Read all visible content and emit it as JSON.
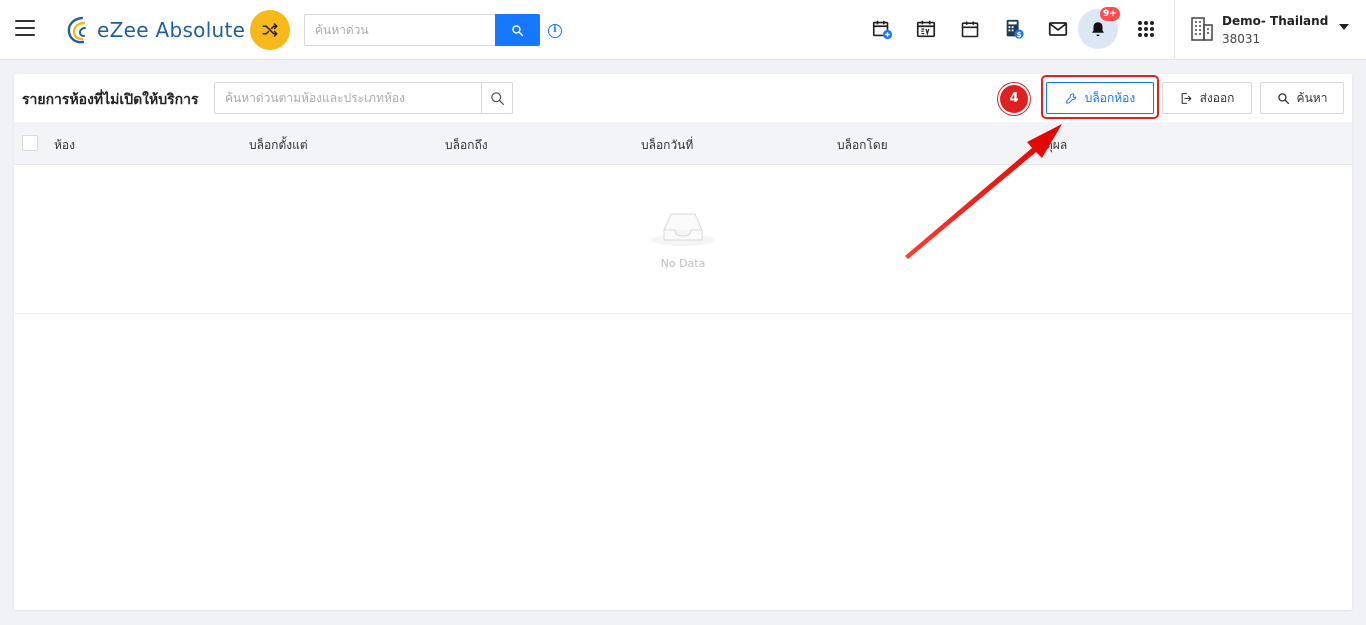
{
  "header": {
    "brand": "eZee Absolute",
    "search_placeholder": "ค้นหาด่วน",
    "notification_badge": "9+",
    "hotel_name": "Demo- Thailand",
    "hotel_id": "38031",
    "icons": [
      "menu-icon",
      "shuffle-icon",
      "search-icon",
      "info-icon",
      "calendar-add-icon",
      "calendar-ev-icon",
      "calendar-icon",
      "calculator-dollar-icon",
      "mail-icon",
      "bell-icon",
      "apps-grid-icon",
      "building-icon",
      "caret-down-icon"
    ]
  },
  "page": {
    "title": "รายการห้องที่ไม่เปิดให้บริการ",
    "filter_placeholder": "ค้นหาด่วนตามห้องและประเภทห้อง",
    "step_number": "4",
    "buttons": {
      "block_room": "บล็อกห้อง",
      "export": "ส่งออก",
      "search": "ค้นหา"
    },
    "columns": [
      "ห้อง",
      "บล็อกตั้งแต่",
      "บล็อกถึง",
      "บล็อกวันที่",
      "บล็อกโดย",
      "เหตุผล"
    ],
    "empty_text": "No Data"
  },
  "colors": {
    "accent": "#1677ff",
    "shuffle": "#f6b81a",
    "annotation": "#e51e1e"
  }
}
